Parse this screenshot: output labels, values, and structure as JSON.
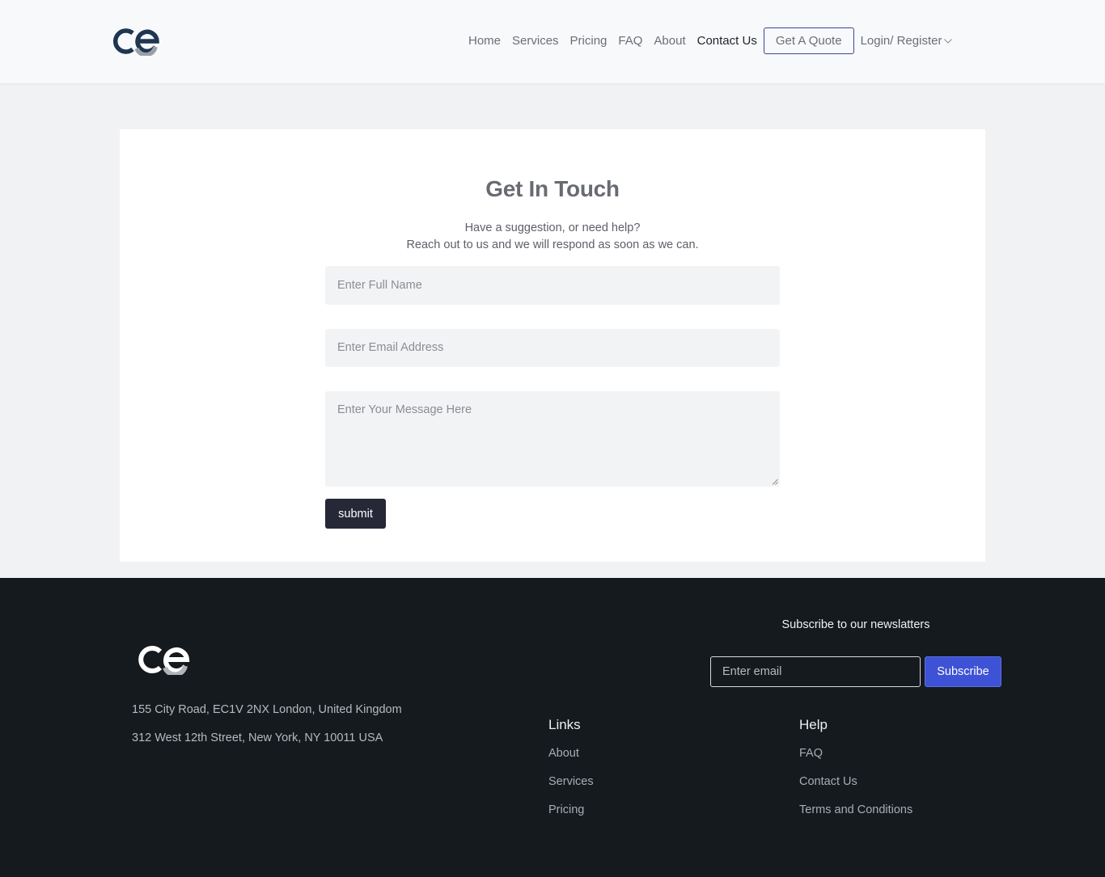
{
  "header": {
    "nav": [
      "Home",
      "Services",
      "Pricing",
      "FAQ",
      "About",
      "Contact Us"
    ],
    "active": "Contact Us",
    "quote_label": "Get A Quote",
    "login_label": "Login/ Register",
    "logo_colors": {
      "primary": "#1f3550",
      "secondary": "#9aa0a8"
    }
  },
  "contact": {
    "title": "Get In Touch",
    "subtitle_line1": "Have a suggestion, or need help?",
    "subtitle_line2": "Reach out to us and we will respond as soon as we can.",
    "name_placeholder": "Enter Full Name",
    "email_placeholder": "Enter Email Address",
    "message_placeholder": "Enter Your Message Here",
    "submit_label": "submit"
  },
  "footer": {
    "address1": "155 City Road, EC1V 2NX London, United Kingdom",
    "address2": "312 West 12th Street, New York, NY 10011 USA",
    "newsletter_title": "Subscribe to our newslatters",
    "newsletter_placeholder": "Enter email",
    "subscribe_label": "Subscribe",
    "links_title": "Links",
    "links": [
      "About",
      "Services",
      "Pricing"
    ],
    "help_title": "Help",
    "help": [
      "FAQ",
      "Contact Us",
      "Terms and Conditions"
    ]
  },
  "colors": {
    "accent": "#3d52d5",
    "footer_bg": "#141a1e",
    "submit_bg": "#262838"
  }
}
